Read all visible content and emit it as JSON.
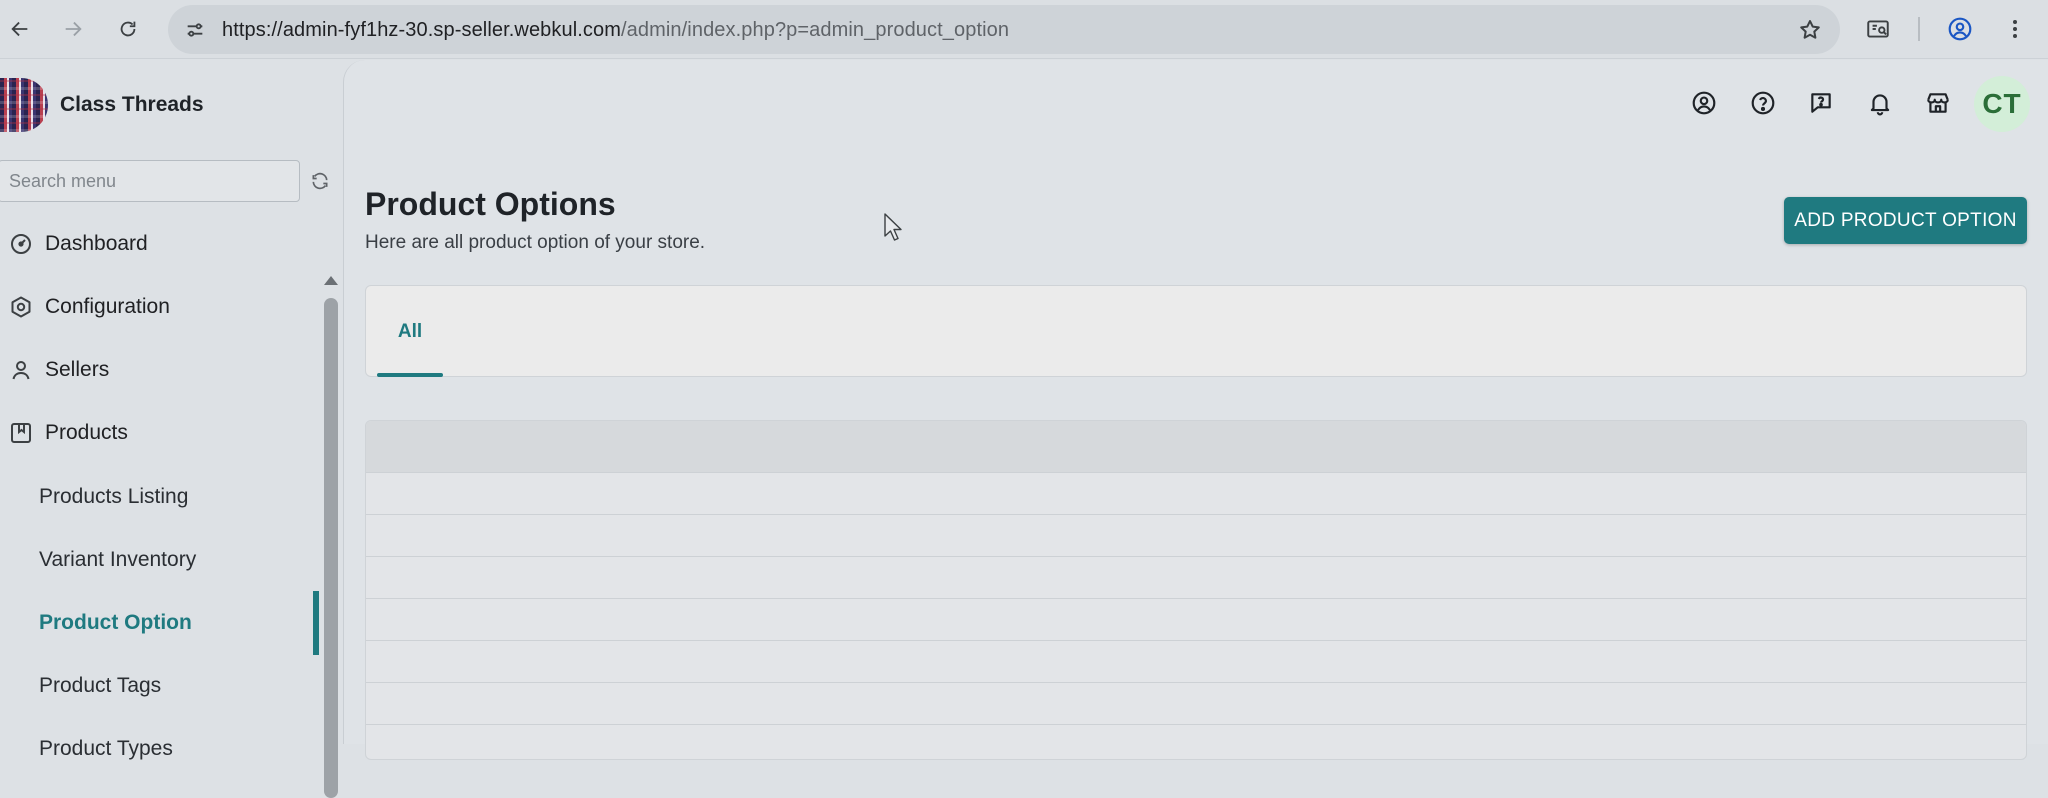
{
  "browser": {
    "url_host": "https://admin-fyf1hz-30.sp-seller.webkul.com",
    "url_path": "/admin/index.php?p=admin_product_option"
  },
  "sidebar": {
    "brand_name": "Class Threads",
    "search_placeholder": "Search menu",
    "items": [
      {
        "label": "Dashboard",
        "icon": "dashboard-icon"
      },
      {
        "label": "Configuration",
        "icon": "hexagon-gear-icon"
      },
      {
        "label": "Sellers",
        "icon": "person-icon"
      },
      {
        "label": "Products",
        "icon": "bookmark-box-icon"
      }
    ],
    "subitems": [
      {
        "label": "Products Listing",
        "active": false
      },
      {
        "label": "Variant Inventory",
        "active": false
      },
      {
        "label": "Product Option",
        "active": true
      },
      {
        "label": "Product Tags",
        "active": false
      },
      {
        "label": "Product Types",
        "active": false
      }
    ]
  },
  "header": {
    "avatar_initials": "CT",
    "icons": [
      "account-icon",
      "help-icon",
      "support-chat-icon",
      "bell-icon",
      "store-icon"
    ]
  },
  "main": {
    "title": "Product Options",
    "subtitle": "Here are all product option of your store.",
    "add_button_label": "ADD PRODUCT OPTION",
    "tabs": [
      {
        "label": "All",
        "active": true
      }
    ]
  },
  "colors": {
    "accent": "#1f7a80",
    "avatar_bg": "#d3eed8",
    "avatar_text": "#2b6e38"
  }
}
